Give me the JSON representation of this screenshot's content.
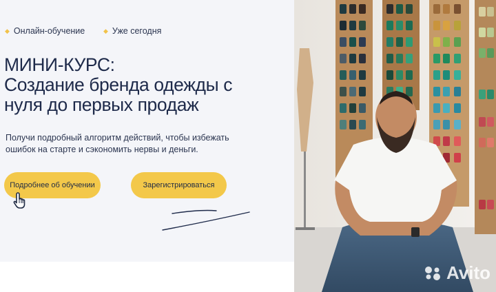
{
  "hero": {
    "tags": [
      "Онлайн-обучение",
      "Уже сегодня"
    ],
    "headline": [
      "МИНИ-КУРС:",
      "Создание бренда одежды с",
      "нуля до первых продаж"
    ],
    "description": [
      "Получи подробный алгоритм действий, чтобы избежать",
      "ошибок на старте и сэкономить нервы и деньги."
    ],
    "buttons": {
      "more": "Подробнее об обучении",
      "register": "Зарегистрироваться"
    }
  },
  "watermark": {
    "text": "Avito"
  },
  "colors": {
    "accent": "#f3c84a",
    "text": "#1e2a4a",
    "panel": "#f4f5f9"
  },
  "icons": {
    "bullet": "diamond-bullet-icon",
    "cursor": "hand-pointer-icon",
    "watermark": "avito-logo-icon"
  }
}
